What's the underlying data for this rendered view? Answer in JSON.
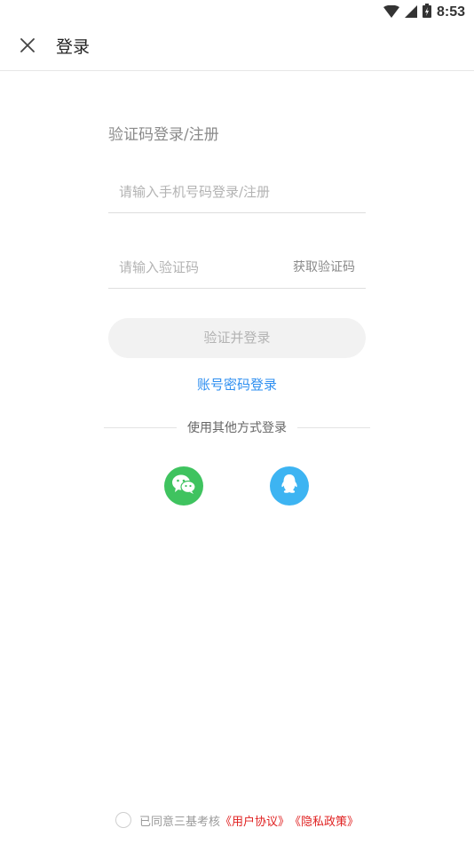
{
  "status_bar": {
    "time": "8:53",
    "icons": [
      "wifi-icon",
      "cell-signal-icon",
      "battery-icon"
    ]
  },
  "header": {
    "title": "登录",
    "close_icon": "close-icon"
  },
  "form": {
    "section_title": "验证码登录/注册",
    "phone_placeholder": "请输入手机号码登录/注册",
    "code_placeholder": "请输入验证码",
    "get_code_label": "获取验证码",
    "submit_label": "验证并登录",
    "password_login_label": "账号密码登录"
  },
  "other_login": {
    "divider_label": "使用其他方式登录",
    "methods": [
      {
        "icon": "wechat-icon",
        "color": "#3fc35f"
      },
      {
        "icon": "qq-icon",
        "color": "#3db4f2"
      }
    ]
  },
  "agreement": {
    "prefix": "已同意三基考核",
    "user_agreement": "《用户协议》",
    "privacy_policy": "《隐私政策》"
  },
  "colors": {
    "link_blue": "#2f8ff0",
    "agreement_red": "#e02020",
    "button_bg": "#f2f2f2"
  }
}
